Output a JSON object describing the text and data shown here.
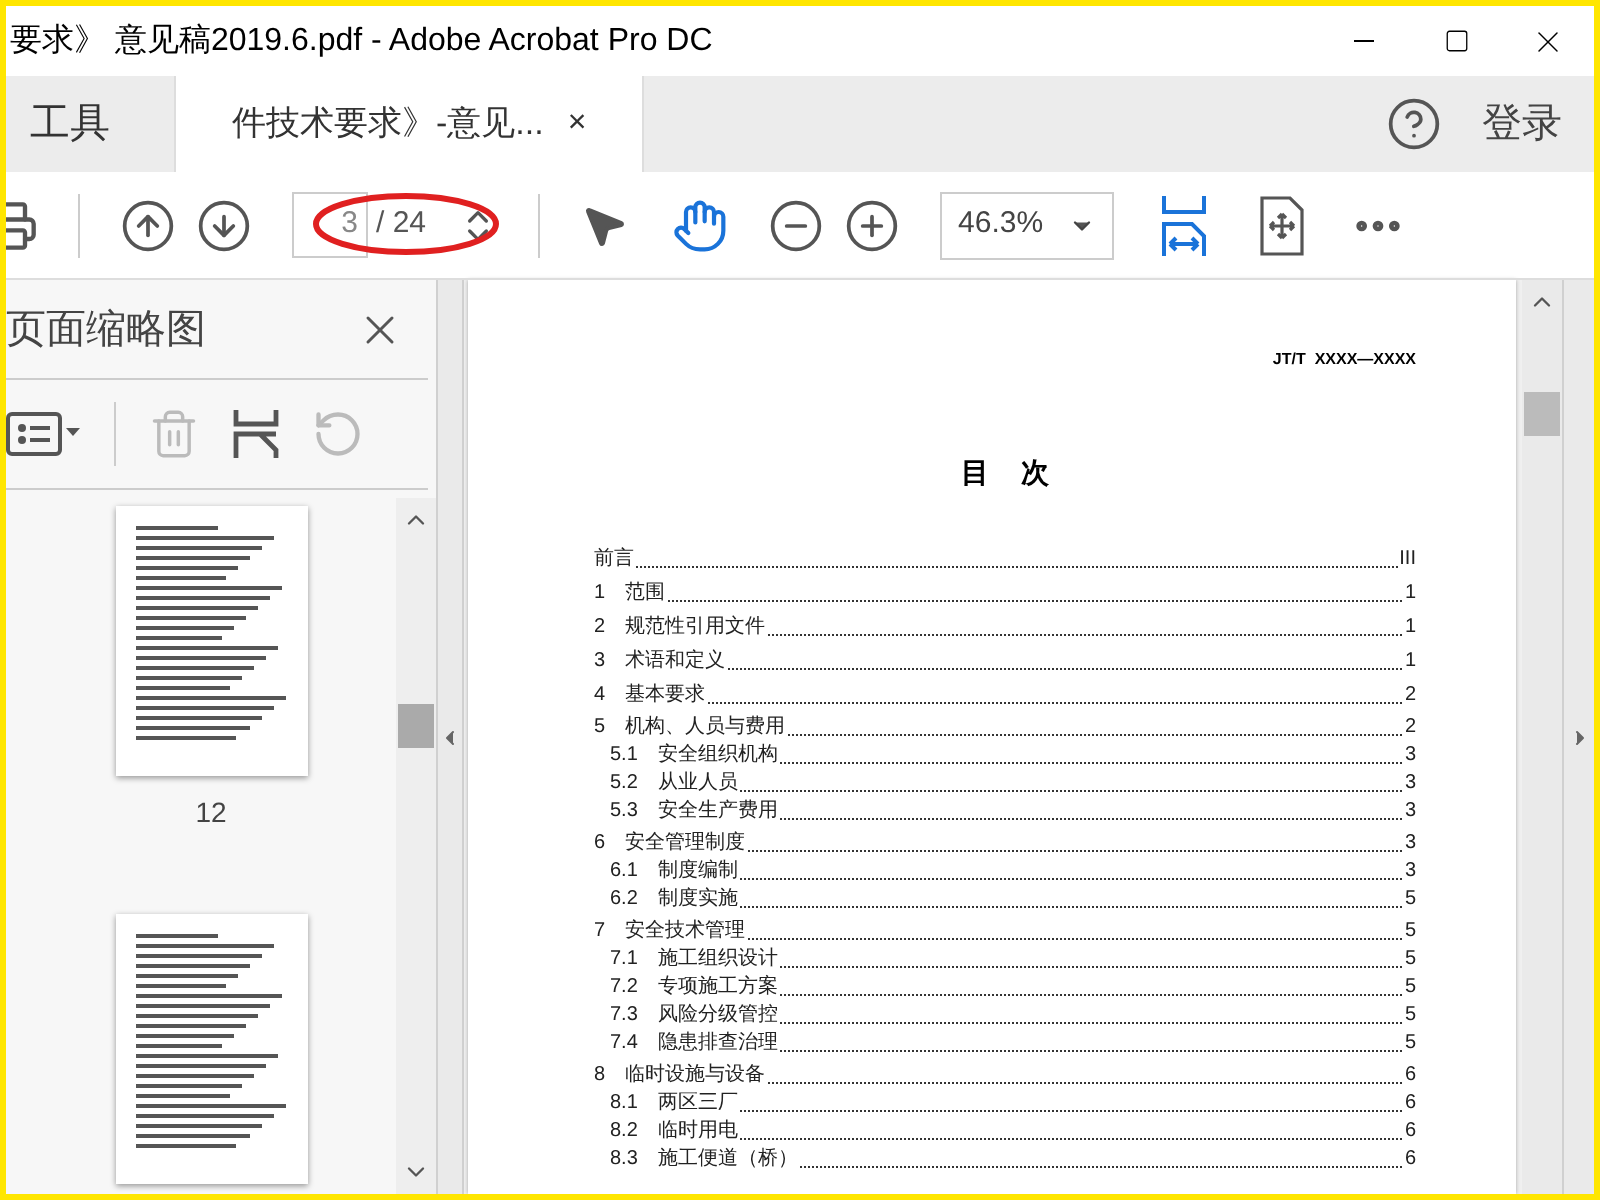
{
  "window": {
    "title": "要求》 意见稿2019.6.pdf - Adobe Acrobat Pro DC"
  },
  "tabs": [
    {
      "label": "工具",
      "selected": false
    },
    {
      "label": "件技术要求》-意见...",
      "selected": true,
      "close": "×"
    }
  ],
  "account": {
    "sign_in": "登录"
  },
  "toolbar": {
    "page_value": "3",
    "page_total": "/ 24",
    "zoom": "46.3%"
  },
  "thumbnails_panel": {
    "title": "页面缩略图",
    "pages": [
      {
        "kind": "thumbnail",
        "label": "12"
      },
      {
        "kind": "thumbnail"
      }
    ]
  },
  "document": {
    "header": "JT/T  XXXX—XXXX",
    "heading": "目    次",
    "toc": [
      {
        "title": "前言",
        "page": "III"
      },
      {
        "number": "1",
        "title": "范围",
        "page": "1"
      },
      {
        "number": "2",
        "title": "规范性引用文件",
        "page": "1"
      },
      {
        "number": "3",
        "title": "术语和定义",
        "page": "1"
      },
      {
        "number": "4",
        "title": "基本要求",
        "page": "2"
      },
      {
        "number": "5",
        "title": "机构、人员与费用",
        "page": "2",
        "children": [
          {
            "number": "5.1",
            "title": "安全组织机构",
            "page": "3"
          },
          {
            "number": "5.2",
            "title": "从业人员",
            "page": "3"
          },
          {
            "number": "5.3",
            "title": "安全生产费用",
            "page": "3"
          }
        ]
      },
      {
        "number": "6",
        "title": "安全管理制度",
        "page": "3",
        "children": [
          {
            "number": "6.1",
            "title": "制度编制",
            "page": "3"
          },
          {
            "number": "6.2",
            "title": "制度实施",
            "page": "5"
          }
        ]
      },
      {
        "number": "7",
        "title": "安全技术管理",
        "page": "5",
        "children": [
          {
            "number": "7.1",
            "title": "施工组织设计",
            "page": "5"
          },
          {
            "number": "7.2",
            "title": "专项施工方案",
            "page": "5"
          },
          {
            "number": "7.3",
            "title": "风险分级管控",
            "page": "5"
          },
          {
            "number": "7.4",
            "title": "隐患排查治理",
            "page": "5"
          }
        ]
      },
      {
        "number": "8",
        "title": "临时设施与设备",
        "page": "6",
        "children": [
          {
            "number": "8.1",
            "title": "两区三厂",
            "page": "6"
          },
          {
            "number": "8.2",
            "title": "临时用电",
            "page": "6"
          },
          {
            "number": "8.3",
            "title": "施工便道（桥）",
            "page": "6"
          }
        ]
      }
    ]
  }
}
